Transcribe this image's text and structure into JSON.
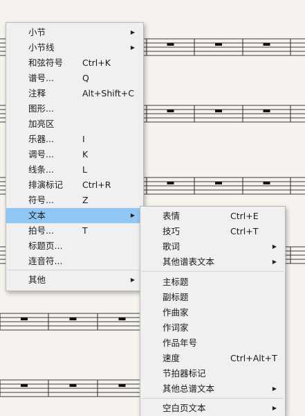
{
  "main_menu": {
    "items": [
      {
        "label": "小节",
        "shortcut": "",
        "submenu": true
      },
      {
        "label": "小节线",
        "shortcut": "",
        "submenu": true
      },
      {
        "label": "和弦符号",
        "shortcut": "Ctrl+K",
        "submenu": false
      },
      {
        "label": "谱号...",
        "shortcut": "Q",
        "submenu": false
      },
      {
        "label": "注释",
        "shortcut": "Alt+Shift+C",
        "submenu": false
      },
      {
        "label": "图形...",
        "shortcut": "",
        "submenu": false
      },
      {
        "label": "加亮区",
        "shortcut": "",
        "submenu": false
      },
      {
        "label": "乐器...",
        "shortcut": "I",
        "submenu": false
      },
      {
        "label": "调号...",
        "shortcut": "K",
        "submenu": false
      },
      {
        "label": "线条...",
        "shortcut": "L",
        "submenu": false
      },
      {
        "label": "排演标记",
        "shortcut": "Ctrl+R",
        "submenu": false
      },
      {
        "label": "符号...",
        "shortcut": "Z",
        "submenu": false
      },
      {
        "label": "文本",
        "shortcut": "",
        "submenu": true,
        "active": true
      },
      {
        "label": "拍号...",
        "shortcut": "T",
        "submenu": false
      },
      {
        "label": "标题页...",
        "shortcut": "",
        "submenu": false
      },
      {
        "label": "连音符...",
        "shortcut": "",
        "submenu": false
      },
      {
        "label": "其他",
        "shortcut": "",
        "submenu": true
      }
    ]
  },
  "text_submenu": {
    "items": [
      {
        "label": "表情",
        "shortcut": "Ctrl+E",
        "submenu": false
      },
      {
        "label": "技巧",
        "shortcut": "Ctrl+T",
        "submenu": false
      },
      {
        "label": "歌词",
        "shortcut": "",
        "submenu": true
      },
      {
        "label": "其他谱表文本",
        "shortcut": "",
        "submenu": true
      },
      {
        "label": "主标题",
        "shortcut": "",
        "submenu": false
      },
      {
        "label": "副标题",
        "shortcut": "",
        "submenu": false
      },
      {
        "label": "作曲家",
        "shortcut": "",
        "submenu": false
      },
      {
        "label": "作词家",
        "shortcut": "",
        "submenu": false
      },
      {
        "label": "作品年号",
        "shortcut": "",
        "submenu": false
      },
      {
        "label": "速度",
        "shortcut": "Ctrl+Alt+T",
        "submenu": false
      },
      {
        "label": "节拍器标记",
        "shortcut": "",
        "submenu": false
      },
      {
        "label": "其他总谱文本",
        "shortcut": "",
        "submenu": true
      },
      {
        "label": "空白页文本",
        "shortcut": "",
        "submenu": true
      }
    ]
  },
  "icons": {
    "submenu_arrow": "triangle-right-icon"
  }
}
